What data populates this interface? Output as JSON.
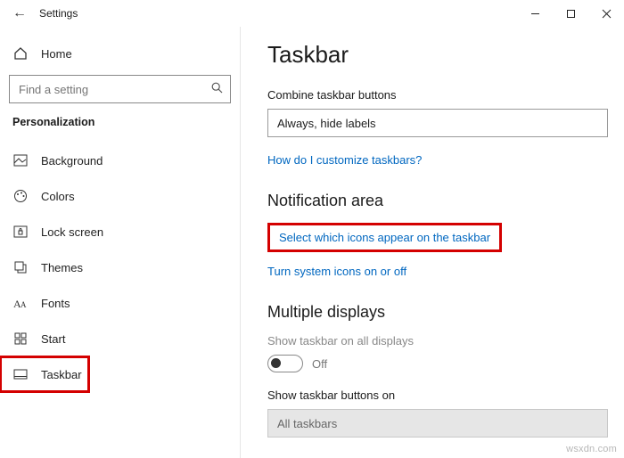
{
  "titlebar": {
    "app_title": "Settings"
  },
  "sidebar": {
    "home_label": "Home",
    "search_placeholder": "Find a setting",
    "category_label": "Personalization",
    "items": [
      {
        "label": "Background",
        "icon": "picture-icon"
      },
      {
        "label": "Colors",
        "icon": "palette-icon"
      },
      {
        "label": "Lock screen",
        "icon": "lock-icon"
      },
      {
        "label": "Themes",
        "icon": "themes-icon"
      },
      {
        "label": "Fonts",
        "icon": "fonts-icon"
      },
      {
        "label": "Start",
        "icon": "start-icon"
      },
      {
        "label": "Taskbar",
        "icon": "taskbar-icon"
      }
    ]
  },
  "main": {
    "page_title": "Taskbar",
    "combine_label": "Combine taskbar buttons",
    "combine_value": "Always, hide labels",
    "customize_link": "How do I customize taskbars?",
    "notification_header": "Notification area",
    "select_icons_link": "Select which icons appear on the taskbar",
    "system_icons_link": "Turn system icons on or off",
    "multiple_header": "Multiple displays",
    "show_all_label": "Show taskbar on all displays",
    "toggle_state": "Off",
    "show_buttons_label": "Show taskbar buttons on",
    "show_buttons_value": "All taskbars"
  },
  "watermark": "wsxdn.com"
}
